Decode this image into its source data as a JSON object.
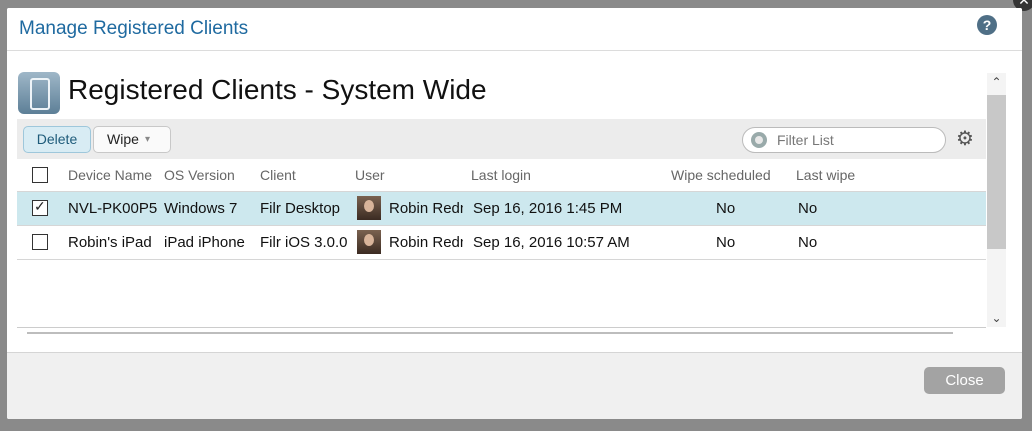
{
  "dialog": {
    "title": "Manage Registered Clients",
    "help_icon": "help-icon",
    "close_icon": "close-icon"
  },
  "panel": {
    "title": "Registered Clients - System Wide",
    "icon": "mobile-device-icon"
  },
  "toolbar": {
    "delete_label": "Delete",
    "wipe_label": "Wipe",
    "wipe_caret": "▾",
    "filter_placeholder": "Filter List",
    "settings_icon": "gear-icon"
  },
  "table": {
    "columns": [
      "Device Name",
      "OS Version",
      "Client",
      "User",
      "Last login",
      "Wipe scheduled",
      "Last wipe"
    ],
    "rows": [
      {
        "selected": true,
        "device": "NVL-PK00P5",
        "os": "Windows 7",
        "client": "Filr Desktop",
        "user": "Robin Redmond",
        "last_login": "Sep 16, 2016 1:45 PM",
        "wipe_scheduled": "No",
        "last_wipe": "No"
      },
      {
        "selected": false,
        "device": "Robin's iPad",
        "os": "iPad iPhone",
        "client": "Filr iOS 3.0.0",
        "user": "Robin Redmond",
        "last_login": "Sep 16, 2016 10:57 AM",
        "wipe_scheduled": "No",
        "last_wipe": "No"
      }
    ]
  },
  "footer": {
    "close_label": "Close"
  },
  "colors": {
    "title_blue": "#1f6aa0",
    "selected_row": "#cde8ee",
    "delete_button_bg": "#d8ecf4",
    "close_button_bg": "#a3a3a3"
  }
}
